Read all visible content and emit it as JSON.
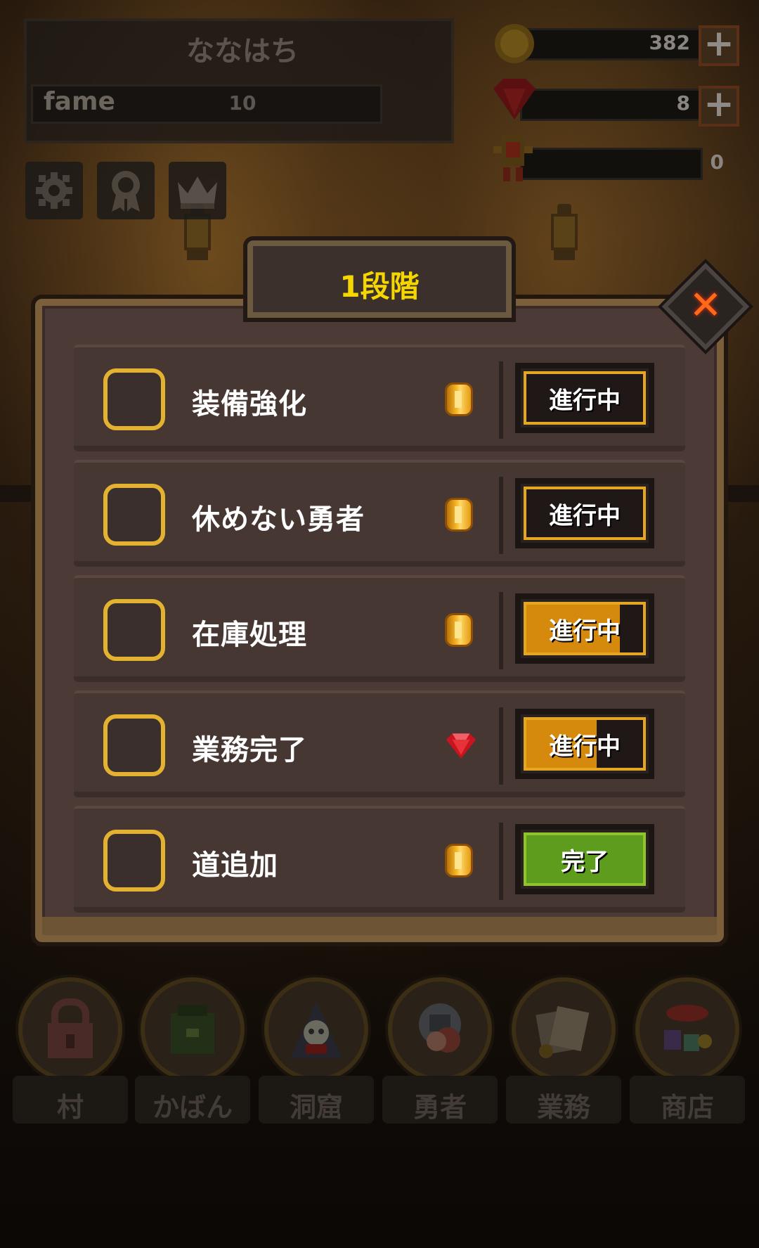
{
  "player": {
    "name": "ななはち",
    "fame_label": "fame",
    "fame_value": "10"
  },
  "currencies": [
    {
      "icon": "gold-coin-icon",
      "value": "382",
      "has_plus": true
    },
    {
      "icon": "ruby-gem-icon",
      "value": "8",
      "has_plus": true
    },
    {
      "icon": "medal-icon",
      "value": "0",
      "has_plus": false
    }
  ],
  "toolbar": {
    "plus_label": "+"
  },
  "tool_icons": [
    "gear-icon",
    "ribbon-award-icon",
    "crown-icon"
  ],
  "modal": {
    "title": "1段階",
    "close_label": "✕",
    "quests": [
      {
        "label": "装備強化",
        "reward": "coin",
        "status": "進行中",
        "progress": 0
      },
      {
        "label": "休めない勇者",
        "reward": "coin",
        "status": "進行中",
        "progress": 0
      },
      {
        "label": "在庫処理",
        "reward": "coin",
        "status": "進行中",
        "progress": 0.8
      },
      {
        "label": "業務完了",
        "reward": "ruby",
        "status": "進行中",
        "progress": 0.6
      },
      {
        "label": "道追加",
        "reward": "coin",
        "status": "完了",
        "progress": 1
      }
    ]
  },
  "nav": [
    {
      "label": "村",
      "icon": "lock-icon"
    },
    {
      "label": "かばん",
      "icon": "bag-icon"
    },
    {
      "label": "洞窟",
      "icon": "skull-icon"
    },
    {
      "label": "勇者",
      "icon": "hero-icon"
    },
    {
      "label": "業務",
      "icon": "scroll-icon"
    },
    {
      "label": "商店",
      "icon": "shop-icon"
    }
  ],
  "colors": {
    "accent_gold": "#e3b230",
    "title_yellow": "#f5d600",
    "progress_orange": "#d68a0d",
    "done_green": "#5e9c1e"
  }
}
